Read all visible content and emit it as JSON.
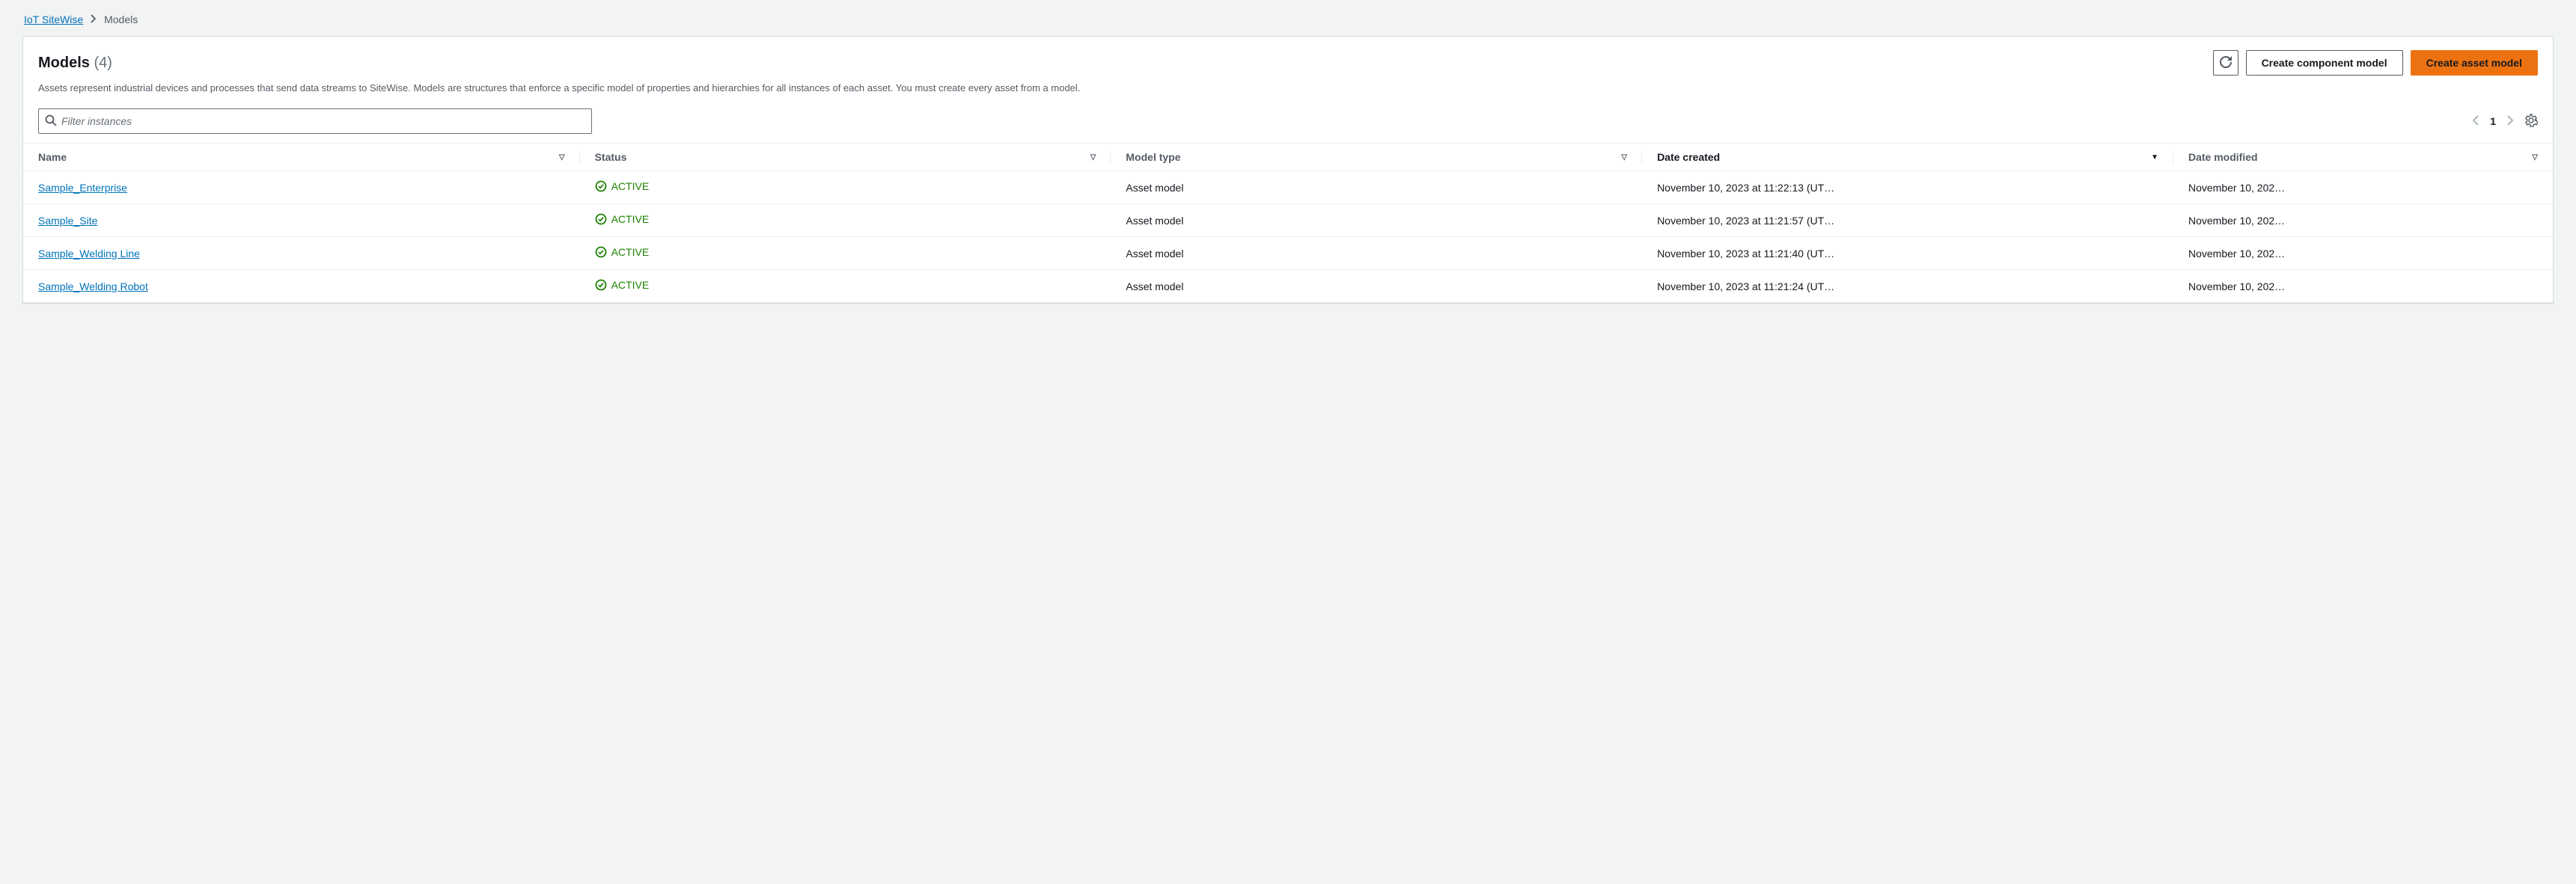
{
  "breadcrumb": {
    "root": "IoT SiteWise",
    "current": "Models"
  },
  "header": {
    "title": "Models",
    "count": "(4)",
    "description": "Assets represent industrial devices and processes that send data streams to SiteWise. Models are structures that enforce a specific model of properties and hierarchies for all instances of each asset. You must create every asset from a model."
  },
  "actions": {
    "create_component": "Create component model",
    "create_asset": "Create asset model"
  },
  "search": {
    "placeholder": "Filter instances"
  },
  "pagination": {
    "page": "1"
  },
  "columns": {
    "name": "Name",
    "status": "Status",
    "model_type": "Model type",
    "date_created": "Date created",
    "date_modified": "Date modified"
  },
  "rows": [
    {
      "name": "Sample_Enterprise",
      "status": "ACTIVE",
      "model_type": "Asset model",
      "date_created": "November 10, 2023 at 11:22:13 (UT…",
      "date_modified": "November 10, 202…"
    },
    {
      "name": "Sample_Site",
      "status": "ACTIVE",
      "model_type": "Asset model",
      "date_created": "November 10, 2023 at 11:21:57 (UT…",
      "date_modified": "November 10, 202…"
    },
    {
      "name": "Sample_Welding Line",
      "status": "ACTIVE",
      "model_type": "Asset model",
      "date_created": "November 10, 2023 at 11:21:40 (UT…",
      "date_modified": "November 10, 202…"
    },
    {
      "name": "Sample_Welding Robot",
      "status": "ACTIVE",
      "model_type": "Asset model",
      "date_created": "November 10, 2023 at 11:21:24 (UT…",
      "date_modified": "November 10, 202…"
    }
  ]
}
